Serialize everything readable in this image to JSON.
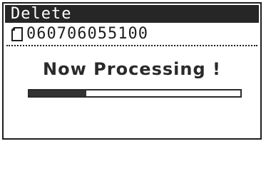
{
  "header": {
    "title": "Delete"
  },
  "file": {
    "icon": "file-icon",
    "name": "060706055100"
  },
  "status": {
    "message": "Now Processing !"
  },
  "progress": {
    "fraction": 0.27
  },
  "colors": {
    "title_bar_bg": "#262626",
    "title_bar_text": "#ffffff",
    "foreground": "#2a2a2a",
    "background": "#ffffff"
  }
}
